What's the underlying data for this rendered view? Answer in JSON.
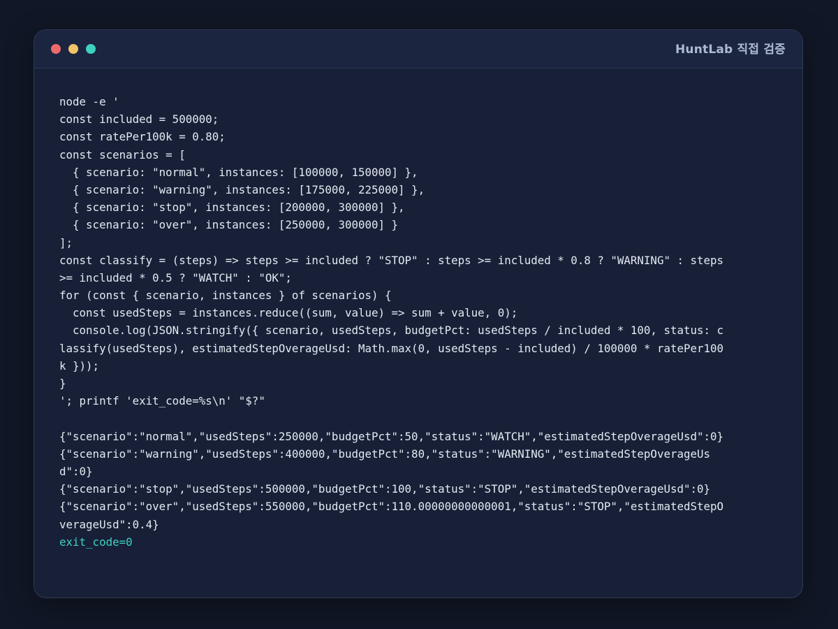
{
  "window": {
    "title": "HuntLab 직접 검증"
  },
  "colors": {
    "background": "#111726",
    "panel": "#172036",
    "titlebar": "#1b2540",
    "text": "#e4e9f3",
    "accent": "#3fd1c0",
    "close": "#ee6a6a",
    "minimize": "#f2c466",
    "maximize": "#3fd1c0"
  },
  "terminal": {
    "lines": [
      "node -e '",
      "const included = 500000;",
      "const ratePer100k = 0.80;",
      "const scenarios = [",
      "  { scenario: \"normal\", instances: [100000, 150000] },",
      "  { scenario: \"warning\", instances: [175000, 225000] },",
      "  { scenario: \"stop\", instances: [200000, 300000] },",
      "  { scenario: \"over\", instances: [250000, 300000] }",
      "];",
      "const classify = (steps) => steps >= included ? \"STOP\" : steps >= included * 0.8 ? \"WARNING\" : steps",
      ">= included * 0.5 ? \"WATCH\" : \"OK\";",
      "for (const { scenario, instances } of scenarios) {",
      "  const usedSteps = instances.reduce((sum, value) => sum + value, 0);",
      "  console.log(JSON.stringify({ scenario, usedSteps, budgetPct: usedSteps / included * 100, status: c",
      "lassify(usedSteps), estimatedStepOverageUsd: Math.max(0, usedSteps - included) / 100000 * ratePer100",
      "k }));",
      "}",
      "'; printf 'exit_code=%s\\n' \"$?\"",
      "",
      "{\"scenario\":\"normal\",\"usedSteps\":250000,\"budgetPct\":50,\"status\":\"WATCH\",\"estimatedStepOverageUsd\":0}",
      "{\"scenario\":\"warning\",\"usedSteps\":400000,\"budgetPct\":80,\"status\":\"WARNING\",\"estimatedStepOverageUs",
      "d\":0}",
      "{\"scenario\":\"stop\",\"usedSteps\":500000,\"budgetPct\":100,\"status\":\"STOP\",\"estimatedStepOverageUsd\":0}",
      "{\"scenario\":\"over\",\"usedSteps\":550000,\"budgetPct\":110.00000000000001,\"status\":\"STOP\",\"estimatedStepO",
      "verageUsd\":0.4}"
    ],
    "exit_line": "exit_code=0"
  }
}
